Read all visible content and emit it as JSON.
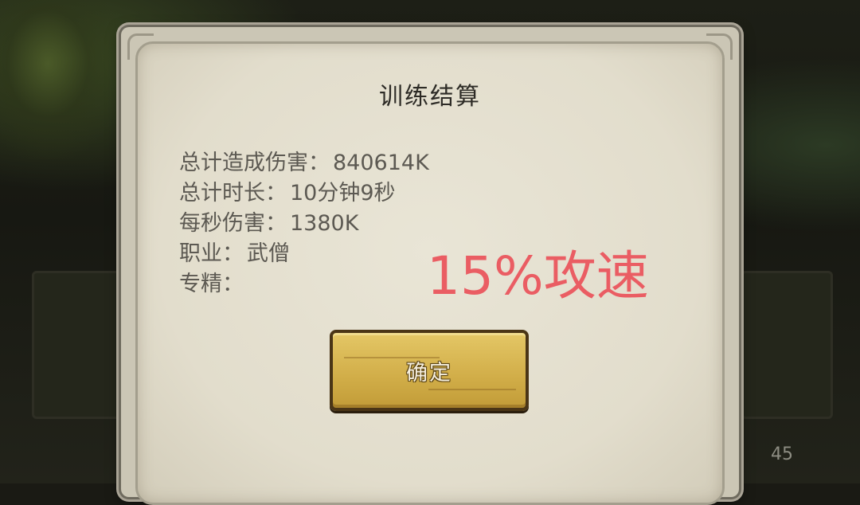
{
  "dialog": {
    "title": "训练结算",
    "stats": [
      {
        "label": "总计造成伤害：",
        "value": "840614K"
      },
      {
        "label": "总计时长：",
        "value": "10分钟9秒"
      },
      {
        "label": "每秒伤害：",
        "value": "1380K"
      },
      {
        "label": "职业：",
        "value": "武僧"
      },
      {
        "label": "专精：",
        "value": ""
      }
    ],
    "confirm_label": "确定"
  },
  "overlay_text": "15%攻速",
  "background": {
    "slot_count": "45"
  },
  "colors": {
    "overlay_text": "#ea5d63",
    "button": "#d1ad48",
    "panel": "#e6e2d3"
  }
}
